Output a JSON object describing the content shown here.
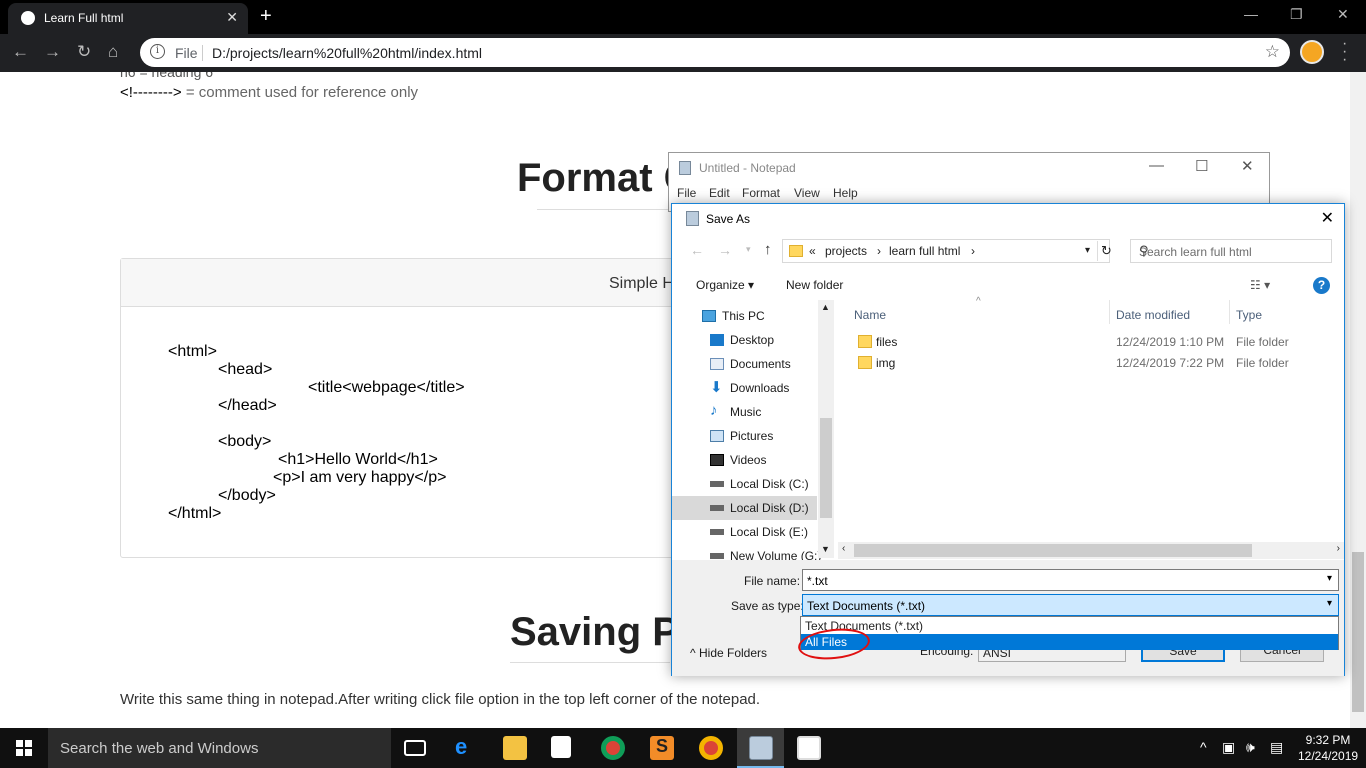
{
  "browser": {
    "tab_title": "Learn Full html",
    "tab_close": "✕",
    "new_tab": "+",
    "url_label": "File",
    "url": "D:/projects/learn%20full%20html/index.html",
    "win_minimize": "—",
    "win_restore": "❐",
    "win_close": "✕"
  },
  "page": {
    "cut_line": "h6 = heading 6",
    "comment_code": "<!-------->",
    "comment_desc": "= comment used for reference only",
    "heading_format": "Format C",
    "card_header": "Simple H",
    "code_lines": [
      "<html>",
      "<head>",
      "<title<webpage</title>",
      "</head>",
      "<body>",
      "<h1>Hello World</h1>",
      "<p>I am very happy</p>",
      "</body>",
      "</html>"
    ],
    "heading_saving": "Saving P",
    "bottom_text": "Write this same thing in notepad.After writing click file option in the top left corner of the notepad."
  },
  "notepad": {
    "title": "Untitled - Notepad",
    "menu": [
      "File",
      "Edit",
      "Format",
      "View",
      "Help"
    ]
  },
  "dialog": {
    "title": "Save As",
    "path": [
      "«",
      "projects",
      "›",
      "learn full html",
      "›"
    ],
    "search_placeholder": "Search learn full html",
    "organize": "Organize ▾",
    "new_folder": "New folder",
    "nav": [
      "This PC",
      "Desktop",
      "Documents",
      "Downloads",
      "Music",
      "Pictures",
      "Videos",
      "Local Disk (C:)",
      "Local Disk (D:)",
      "Local Disk (E:)",
      "New Volume (G:)"
    ],
    "selected_nav": "Local Disk (D:)",
    "columns": [
      "Name",
      "Date modified",
      "Type"
    ],
    "files": [
      {
        "name": "files",
        "date": "12/24/2019 1:10 PM",
        "type": "File folder"
      },
      {
        "name": "img",
        "date": "12/24/2019 7:22 PM",
        "type": "File folder"
      }
    ],
    "file_name_label": "File name:",
    "file_name_value": "*.txt",
    "save_type_label": "Save as type:",
    "save_type_value": "Text Documents (*.txt)",
    "dropdown_options": [
      "Text Documents (*.txt)",
      "All Files"
    ],
    "highlighted_option": "All Files",
    "hide_folders": "Hide Folders",
    "encoding_label": "Encoding:",
    "encoding_value": "ANSI",
    "save_button": "Save",
    "cancel_button": "Cancel"
  },
  "taskbar": {
    "search_placeholder": "Search the web and Windows",
    "time": "9:32 PM",
    "date": "12/24/2019"
  },
  "colors": {
    "accent": "#0078d7",
    "highlight_circle": "#e01010",
    "chrome_dark": "#202124"
  }
}
